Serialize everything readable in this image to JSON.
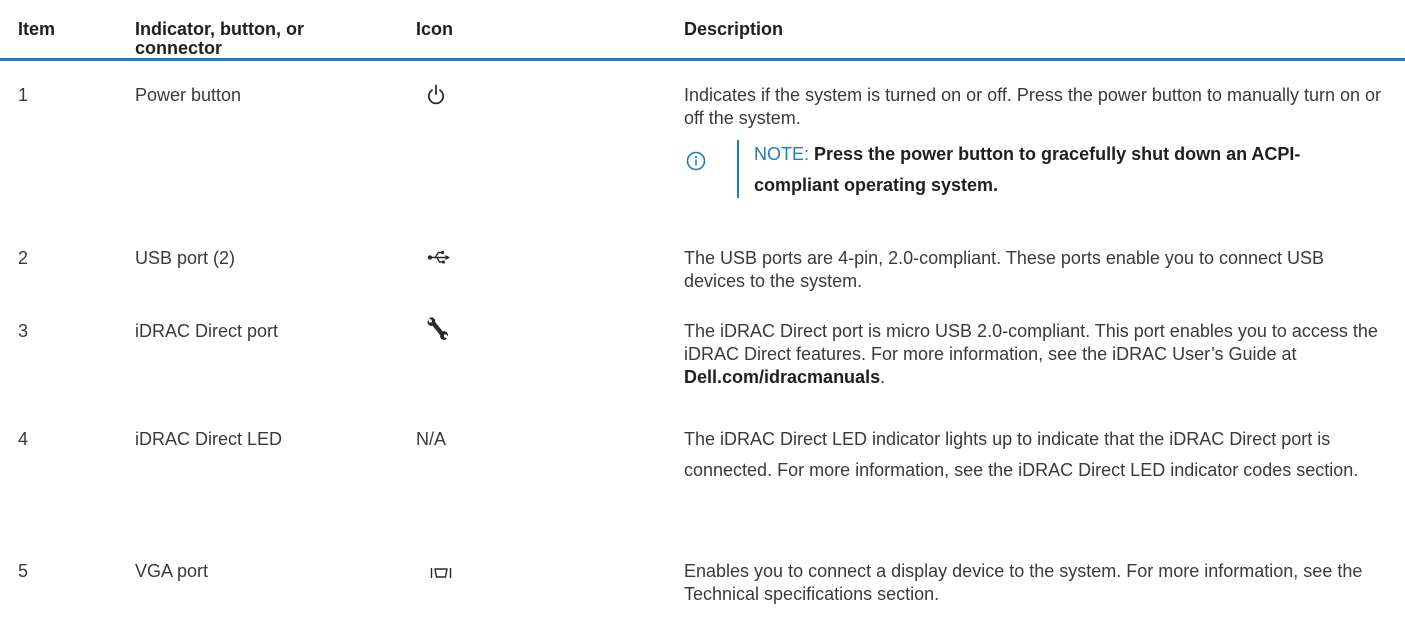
{
  "table": {
    "headers": {
      "item": "Item",
      "indicator_line1": "Indicator, button, or",
      "indicator_line2": "connector",
      "icon": "Icon",
      "description": "Description"
    },
    "rows": [
      {
        "item": "1",
        "indicator": "Power button",
        "icon": "power-icon",
        "description": "Indicates if the system is turned on or off. Press the power button to manually turn on or off the system.",
        "note_label": "NOTE:",
        "note_text": "Press the power button to gracefully shut down an ACPI-compliant operating system."
      },
      {
        "item": "2",
        "indicator": "USB port (2)",
        "icon": "usb-icon",
        "description": "The USB ports are 4-pin, 2.0-compliant. These ports enable you to connect USB devices to the system."
      },
      {
        "item": "3",
        "indicator": "iDRAC Direct port",
        "icon": "wrench-icon",
        "description_before": "The iDRAC Direct port is micro USB 2.0-compliant. This port enables you to access the iDRAC Direct features. For more information, see the iDRAC User’s Guide at ",
        "description_link": "Dell.com/idracmanuals",
        "description_after": "."
      },
      {
        "item": "4",
        "indicator": "iDRAC Direct LED",
        "icon_text": "N/A",
        "description": "The iDRAC Direct LED indicator lights up to indicate that the iDRAC Direct port is connected. For more information, see the iDRAC Direct LED indicator codes section."
      },
      {
        "item": "5",
        "indicator": "VGA port",
        "icon": "vga-icon",
        "description": "Enables you to connect a display device to the system. For more information, see the Technical specifications section."
      }
    ]
  },
  "colors": {
    "accent": "#1b7fc4",
    "text": "#3a3a3a",
    "heading": "#1f1f1f"
  }
}
